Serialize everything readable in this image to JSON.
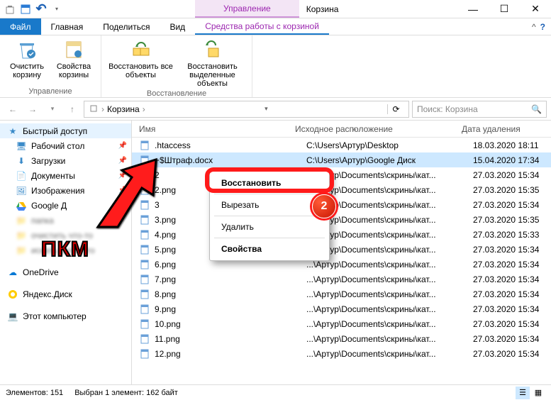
{
  "titlebar": {
    "context_tab": "Управление",
    "title": "Корзина"
  },
  "tabs": {
    "file": "Файл",
    "home": "Главная",
    "share": "Поделиться",
    "view": "Вид",
    "tools": "Средства работы с корзиной"
  },
  "ribbon": {
    "empty": "Очистить корзину",
    "props": "Свойства корзины",
    "restore_all": "Восстановить все объекты",
    "restore_sel": "Восстановить выделенные объекты",
    "group1": "Управление",
    "group2": "Восстановление"
  },
  "breadcrumb": {
    "root": "Корзина",
    "sep": "›"
  },
  "search": {
    "placeholder": "Поиск: Корзина"
  },
  "sidebar": {
    "quick": "Быстрый доступ",
    "desktop": "Рабочий стол",
    "downloads": "Загрузки",
    "documents": "Документы",
    "pictures": "Изображения",
    "gdrive": "Google Д",
    "blurred1": "папка",
    "blurred2": "очистить что-то",
    "blurred3": "искать фото что",
    "onedrive": "OneDrive",
    "yadisk": "Яндекс.Диск",
    "thispc": "Этот компьютер"
  },
  "columns": {
    "name": "Имя",
    "orig": "Исходное расположение",
    "deleted": "Дата удаления"
  },
  "files": [
    {
      "name": ".htaccess",
      "loc": "C:\\Users\\Артур\\Desktop",
      "date": "18.03.2020 18:11",
      "sel": false
    },
    {
      "name": "~$Штраф.docx",
      "loc": "C:\\Users\\Артур\\Google Диск",
      "date": "15.04.2020 17:34",
      "sel": true
    },
    {
      "name": "2",
      "loc": "...\\Артур\\Documents\\скрины\\кат...",
      "date": "27.03.2020 15:34",
      "sel": false
    },
    {
      "name": "2.png",
      "loc": "...\\Артур\\Documents\\скрины\\кат...",
      "date": "27.03.2020 15:35",
      "sel": false
    },
    {
      "name": "3",
      "loc": "...\\Артур\\Documents\\скрины\\кат...",
      "date": "27.03.2020 15:34",
      "sel": false
    },
    {
      "name": "3.png",
      "loc": "...\\Артур\\Documents\\скрины\\кат...",
      "date": "27.03.2020 15:35",
      "sel": false
    },
    {
      "name": "4.png",
      "loc": "...\\Артур\\Documents\\скрины\\кат...",
      "date": "27.03.2020 15:33",
      "sel": false
    },
    {
      "name": "5.png",
      "loc": "...\\Артур\\Documents\\скрины\\кат...",
      "date": "27.03.2020 15:34",
      "sel": false
    },
    {
      "name": "6.png",
      "loc": "...\\Артур\\Documents\\скрины\\кат...",
      "date": "27.03.2020 15:34",
      "sel": false
    },
    {
      "name": "7.png",
      "loc": "...\\Артур\\Documents\\скрины\\кат...",
      "date": "27.03.2020 15:34",
      "sel": false
    },
    {
      "name": "8.png",
      "loc": "...\\Артур\\Documents\\скрины\\кат...",
      "date": "27.03.2020 15:34",
      "sel": false
    },
    {
      "name": "9.png",
      "loc": "...\\Артур\\Documents\\скрины\\кат...",
      "date": "27.03.2020 15:34",
      "sel": false
    },
    {
      "name": "10.png",
      "loc": "...\\Артур\\Documents\\скрины\\кат...",
      "date": "27.03.2020 15:34",
      "sel": false
    },
    {
      "name": "11.png",
      "loc": "...\\Артур\\Documents\\скрины\\кат...",
      "date": "27.03.2020 15:34",
      "sel": false
    },
    {
      "name": "12.png",
      "loc": "...\\Артур\\Documents\\скрины\\кат...",
      "date": "27.03.2020 15:34",
      "sel": false
    }
  ],
  "context_menu": {
    "restore": "Восстановить",
    "cut": "Вырезать",
    "delete": "Удалить",
    "props": "Свойства"
  },
  "overlay": {
    "pkm": "ПКМ",
    "badge": "2"
  },
  "status": {
    "count": "Элементов: 151",
    "sel": "Выбран 1 элемент: 162 байт"
  }
}
